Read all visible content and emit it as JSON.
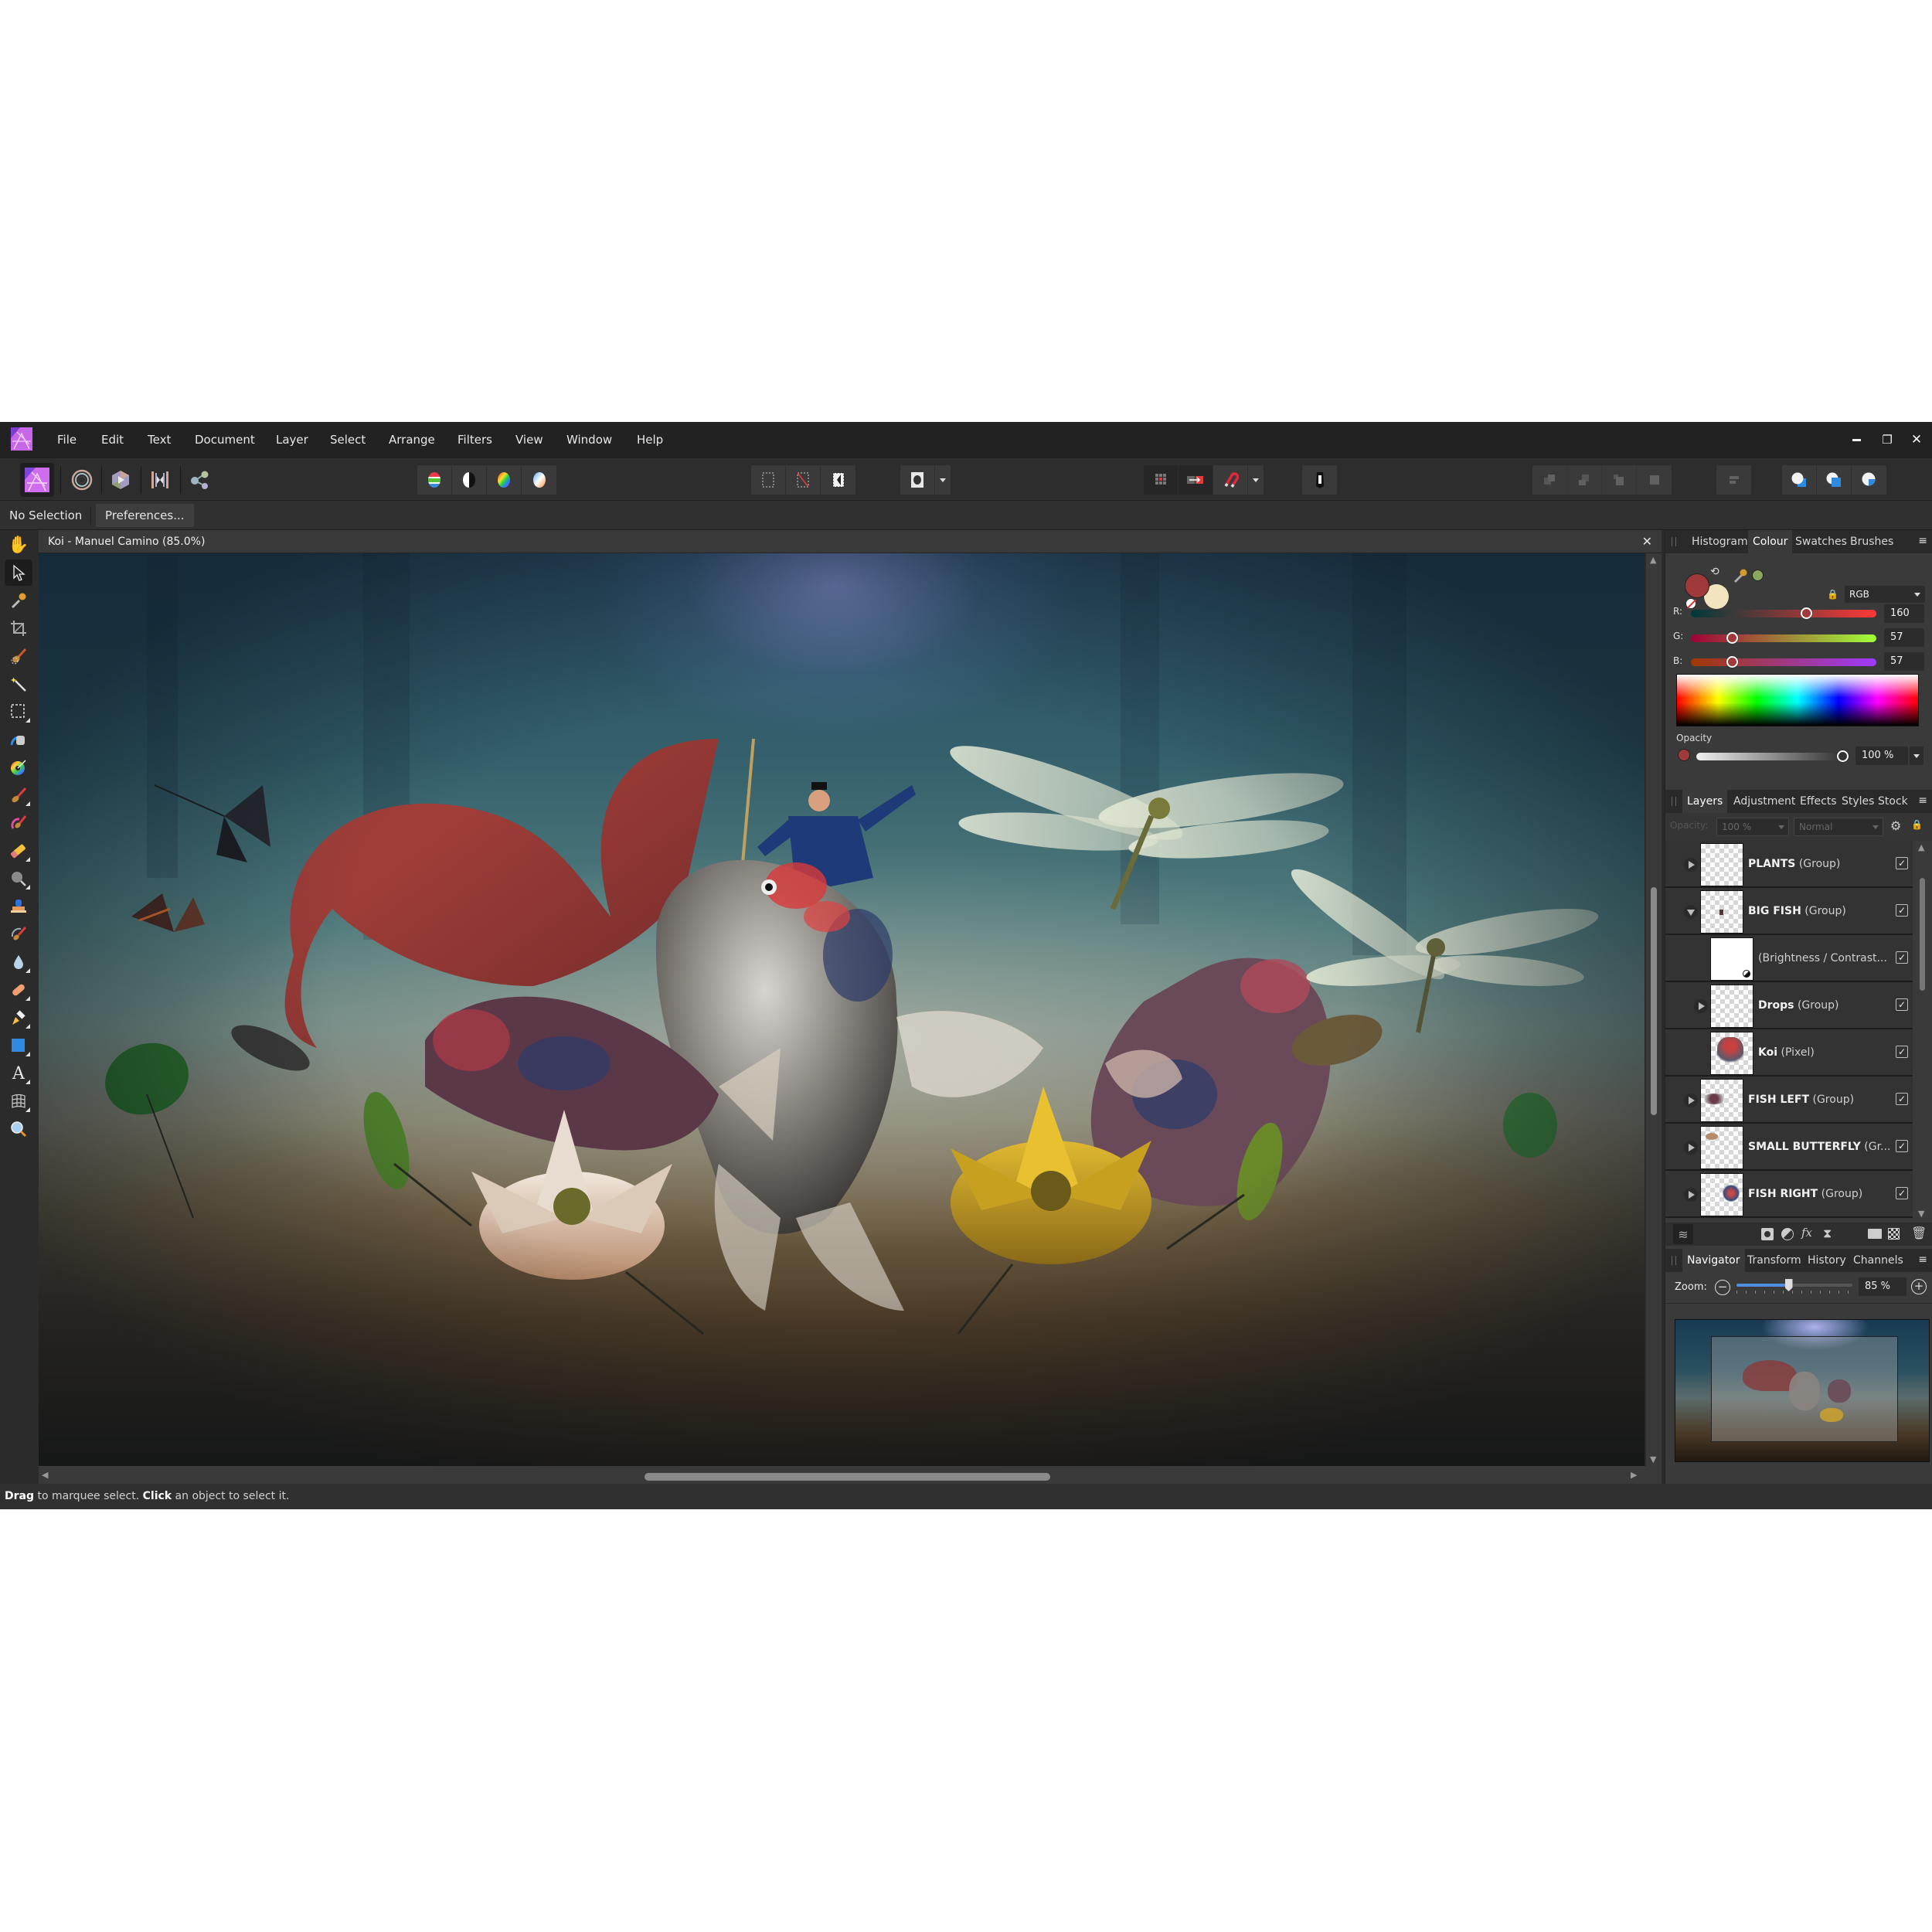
{
  "app": {
    "name": "Affinity Photo",
    "menu": [
      "File",
      "Edit",
      "Text",
      "Document",
      "Layer",
      "Select",
      "Arrange",
      "Filters",
      "View",
      "Window",
      "Help"
    ],
    "window_controls": {
      "minimize": "minimize-icon",
      "restore": "restore-icon",
      "close": "close-icon"
    }
  },
  "toolbar": {
    "personas": [
      {
        "name": "Photo Persona",
        "icon": "photo-persona-icon",
        "active": true
      },
      {
        "name": "Liquify Persona",
        "icon": "liquify-persona-icon",
        "active": false
      },
      {
        "name": "Develop Persona",
        "icon": "develop-persona-icon",
        "active": false
      },
      {
        "name": "Tone Mapping Persona",
        "icon": "tone-mapping-persona-icon",
        "active": false
      },
      {
        "name": "Export Persona",
        "icon": "export-persona-icon",
        "active": false
      }
    ],
    "adjust_group": [
      "auto-levels-icon",
      "auto-contrast-icon",
      "auto-colours-icon",
      "auto-white-balance-icon"
    ],
    "selection_group": [
      "marquee-selection-icon",
      "deselect-icon",
      "invert-pixel-selection-icon"
    ],
    "quickmask": "quick-mask-icon",
    "snapping_group": [
      "grid-snapping-icon",
      "force-pixel-alignment-icon",
      "snapping-magnet-icon"
    ],
    "assistant": "assistant-manager-icon",
    "arrange_group": [
      "move-to-back-icon",
      "move-back-one-icon",
      "move-forward-one-icon",
      "move-to-front-icon"
    ],
    "align": "align-icon",
    "boolean_group": [
      "add-boolean-icon",
      "subtract-boolean-icon",
      "intersect-boolean-icon"
    ]
  },
  "context": {
    "selection_label": "No Selection",
    "preferences_label": "Preferences..."
  },
  "tools": [
    {
      "name": "View Tool",
      "icon": "hand-icon"
    },
    {
      "name": "Move Tool",
      "icon": "pointer-arrow-icon",
      "active": true
    },
    {
      "name": "Colour Picker Tool",
      "icon": "eyedropper-icon"
    },
    {
      "name": "Crop Tool",
      "icon": "crop-icon"
    },
    {
      "name": "Selection Brush Tool",
      "icon": "selection-brush-icon"
    },
    {
      "name": "Flood Select Tool",
      "icon": "magic-wand-icon"
    },
    {
      "name": "Rectangular Marquee Tool",
      "icon": "rect-marquee-icon"
    },
    {
      "name": "Flood Fill Tool",
      "icon": "paint-bucket-icon"
    },
    {
      "name": "Gradient Tool",
      "icon": "colour-wheel-brush-icon"
    },
    {
      "name": "Paint Brush Tool",
      "icon": "paint-brush-icon"
    },
    {
      "name": "Colour Replacement Brush Tool",
      "icon": "colour-replacement-brush-icon"
    },
    {
      "name": "Erase Brush Tool",
      "icon": "eraser-icon"
    },
    {
      "name": "Dodge Brush Tool",
      "icon": "dodge-icon"
    },
    {
      "name": "Clone Brush Tool",
      "icon": "clone-stamp-icon"
    },
    {
      "name": "Undo Brush Tool",
      "icon": "undo-brush-icon"
    },
    {
      "name": "Blur Brush Tool",
      "icon": "blur-drop-icon"
    },
    {
      "name": "Healing Brush Tool",
      "icon": "bandage-icon"
    },
    {
      "name": "Pen Tool",
      "icon": "pen-nib-icon"
    },
    {
      "name": "Rectangle Tool",
      "icon": "rectangle-shape-icon"
    },
    {
      "name": "Artistic Text Tool",
      "icon": "text-a-icon"
    },
    {
      "name": "Mesh Warp Tool",
      "icon": "mesh-warp-icon"
    },
    {
      "name": "Zoom Tool",
      "icon": "magnifier-icon"
    }
  ],
  "document": {
    "title": "Koi - Manuel Camino (85.0%)",
    "close_icon": "close-icon"
  },
  "colour_panel": {
    "tabs": [
      "Histogram",
      "Colour",
      "Swatches",
      "Brushes"
    ],
    "active_tab": "Colour",
    "primary_colour": "#a03939",
    "secondary_colour": "#f3e4c0",
    "picked_colour": "#8aa860",
    "model": "RGB",
    "channels": [
      {
        "label": "R:",
        "value": "160",
        "fraction": 0.627
      },
      {
        "label": "G:",
        "value": "57",
        "fraction": 0.224
      },
      {
        "label": "B:",
        "value": "57",
        "fraction": 0.224
      }
    ],
    "opacity_label": "Opacity",
    "opacity_value": "100 %",
    "opacity_fraction": 1.0
  },
  "layers_panel": {
    "tabs": [
      "Layers",
      "Adjustment",
      "Effects",
      "Styles",
      "Stock"
    ],
    "active_tab": "Layers",
    "opacity_label": "Opacity:",
    "opacity_value": "100 %",
    "blend_mode": "Normal",
    "layers": [
      {
        "name": "PLANTS",
        "type": "(Group)",
        "indent": 0,
        "expander": "closed",
        "visible": true
      },
      {
        "name": "BIG FISH",
        "type": "(Group)",
        "indent": 0,
        "expander": "open",
        "visible": true
      },
      {
        "name": "",
        "type": "(Brightness / Contrast...",
        "indent": 1,
        "expander": "none",
        "visible": true,
        "thumb": "white"
      },
      {
        "name": "Drops",
        "type": "(Group)",
        "indent": 1,
        "expander": "closed",
        "visible": true
      },
      {
        "name": "Koi",
        "type": "(Pixel)",
        "indent": 1,
        "expander": "none",
        "visible": true
      },
      {
        "name": "FISH LEFT",
        "type": "(Group)",
        "indent": 0,
        "expander": "closed",
        "visible": true
      },
      {
        "name": "SMALL BUTTERFLY",
        "type": "(Gr...",
        "indent": 0,
        "expander": "closed",
        "visible": true
      },
      {
        "name": "FISH RIGHT",
        "type": "(Group)",
        "indent": 0,
        "expander": "closed",
        "visible": true
      }
    ],
    "bottom_icons": [
      "layers-stack-icon",
      "mask-layer-icon",
      "adjustment-icon",
      "fx-icon",
      "live-filter-hourglass-icon",
      "group-folder-icon",
      "pixel-layer-icon",
      "trash-icon"
    ]
  },
  "navigator_panel": {
    "tabs": [
      "Navigator",
      "Transform",
      "History",
      "Channels"
    ],
    "active_tab": "Navigator",
    "zoom_label": "Zoom:",
    "zoom_value": "85 %",
    "zoom_fraction": 0.45
  },
  "status": {
    "bold1": "Drag",
    "text1": " to marquee select. ",
    "bold2": "Click",
    "text2": " an object to select it."
  }
}
